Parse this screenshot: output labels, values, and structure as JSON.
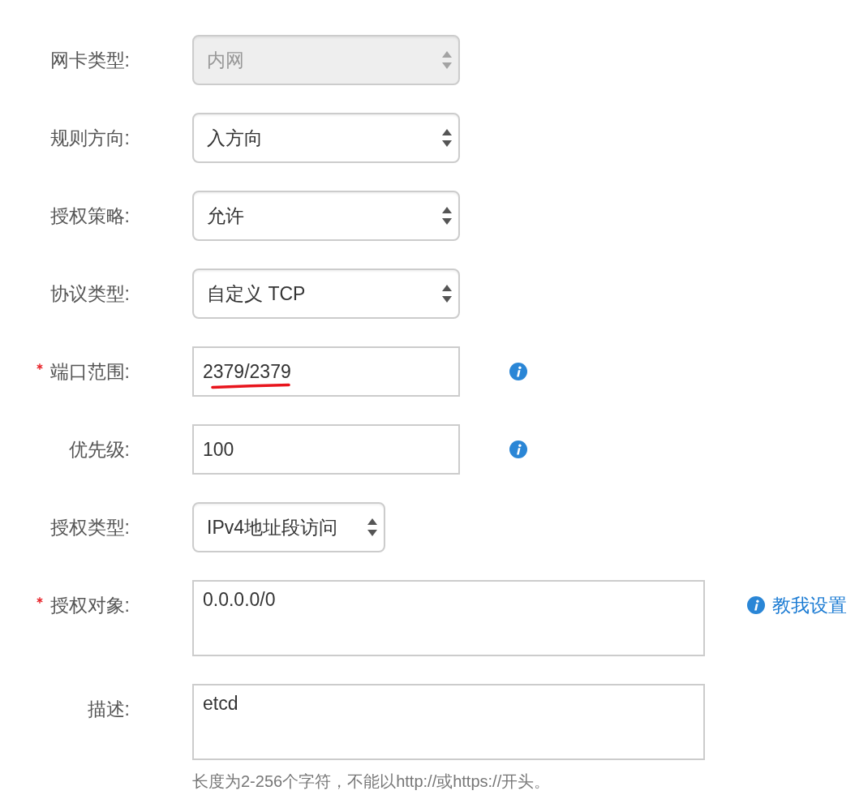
{
  "form": {
    "rows": [
      {
        "label": "网卡类型:",
        "required": false,
        "field": {
          "kind": "select",
          "value": "内网",
          "disabled": true,
          "underlined": false
        }
      },
      {
        "label": "规则方向:",
        "required": false,
        "field": {
          "kind": "select",
          "value": "入方向",
          "disabled": false,
          "underlined": false
        }
      },
      {
        "label": "授权策略:",
        "required": false,
        "field": {
          "kind": "select",
          "value": "允许",
          "disabled": false,
          "underlined": false
        }
      },
      {
        "label": "协议类型:",
        "required": false,
        "field": {
          "kind": "select",
          "value": "自定义 TCP",
          "disabled": false,
          "underlined": false
        }
      },
      {
        "label": "端口范围:",
        "required": true,
        "field": {
          "kind": "input",
          "value": "2379/2379",
          "disabled": false,
          "underlined": true
        },
        "aside": {
          "kind": "info_icon"
        }
      },
      {
        "label": "优先级:",
        "required": false,
        "field": {
          "kind": "input",
          "value": "100",
          "disabled": false,
          "underlined": false
        },
        "aside": {
          "kind": "info_icon"
        }
      },
      {
        "label": "授权类型:",
        "required": false,
        "field": {
          "kind": "select",
          "value": "IPv4地址段访问",
          "disabled": false,
          "underlined": false
        }
      },
      {
        "label": "授权对象:",
        "required": true,
        "field": {
          "kind": "textarea",
          "value": "0.0.0.0/0",
          "disabled": false,
          "underlined": false
        },
        "aside": {
          "kind": "info_link",
          "text": "教我设置"
        }
      },
      {
        "label": "描述:",
        "required": false,
        "field": {
          "kind": "textarea",
          "value": "etcd",
          "disabled": false,
          "underlined": false
        },
        "hint": "长度为2-256个字符，不能以http://或https://开头。"
      }
    ]
  }
}
